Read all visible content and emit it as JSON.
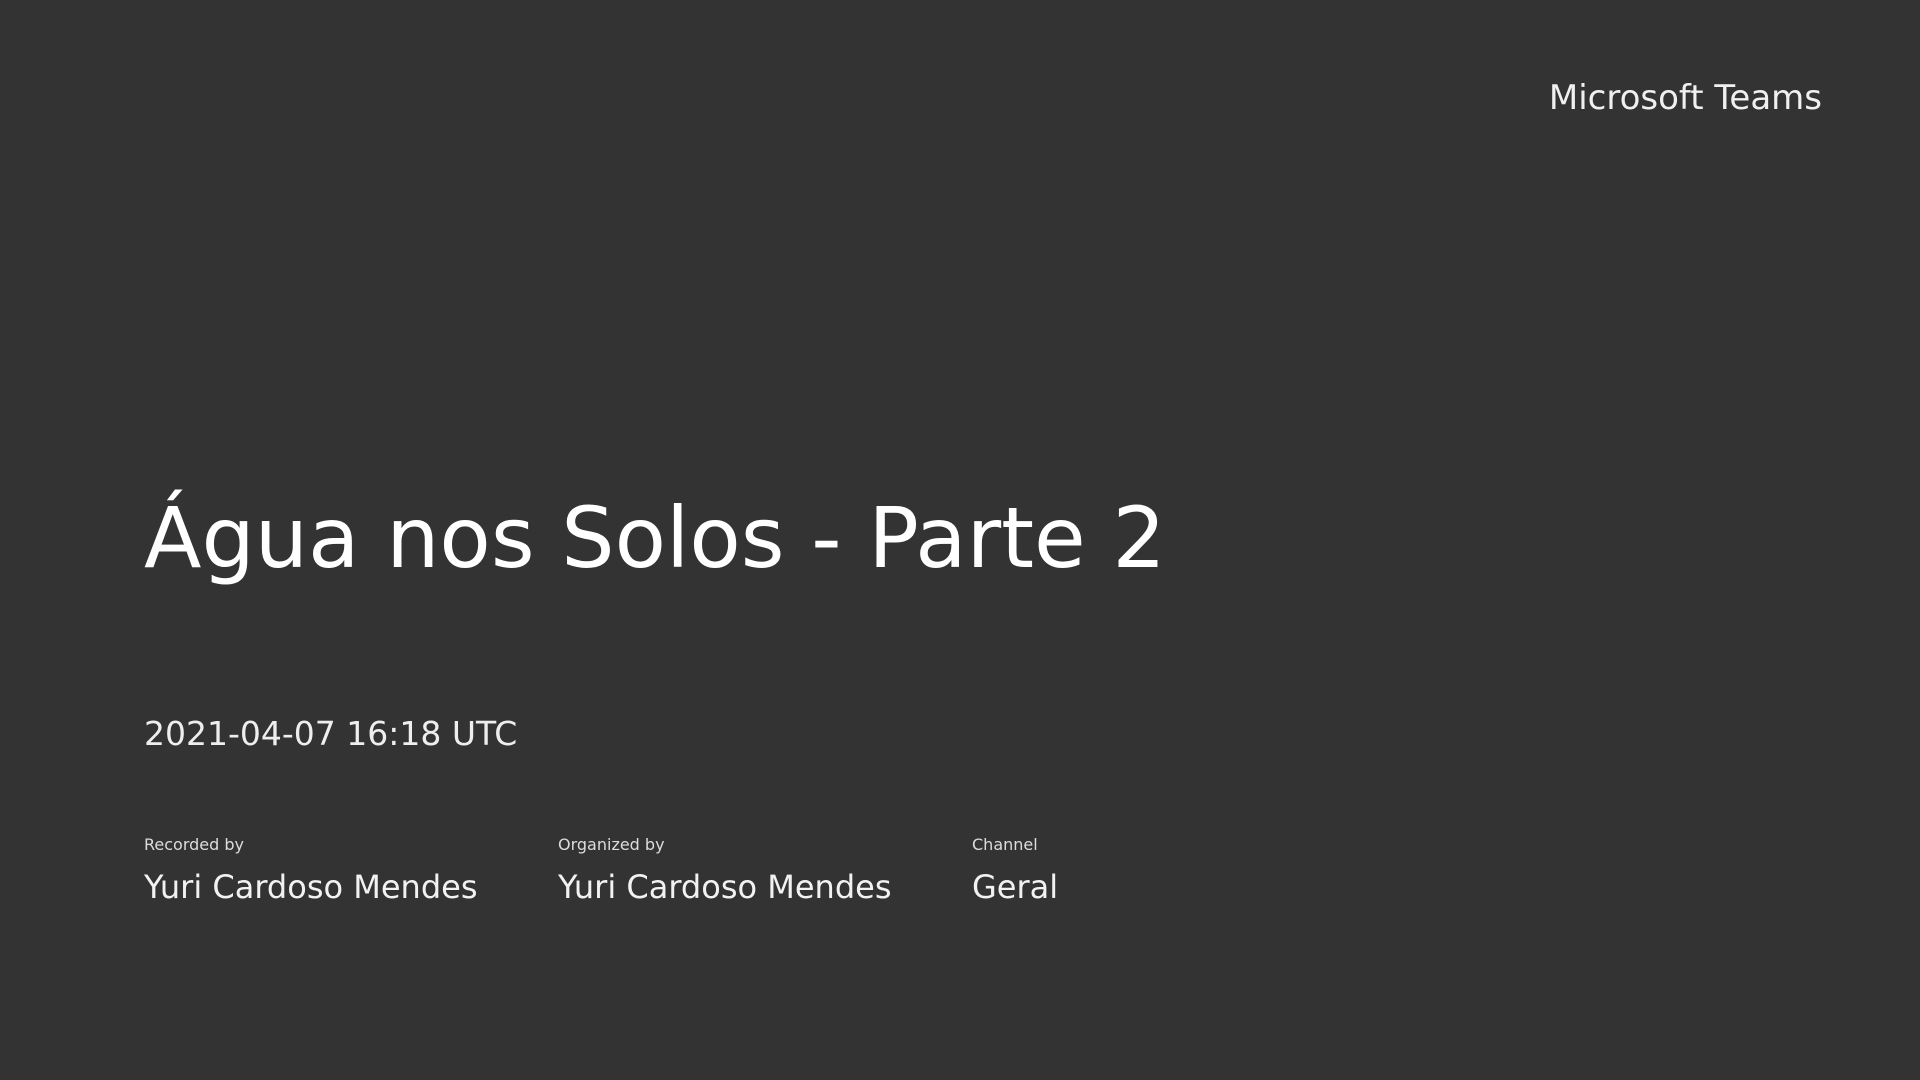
{
  "brand": {
    "name": "Microsoft Teams"
  },
  "recording": {
    "title": "Água nos Solos - Parte 2",
    "datetime": "2021-04-07 16:18 UTC"
  },
  "meta": {
    "recorded_by": {
      "label": "Recorded by",
      "value": "Yuri Cardoso Mendes"
    },
    "organized_by": {
      "label": "Organized by",
      "value": "Yuri Cardoso Mendes"
    },
    "channel": {
      "label": "Channel",
      "value": "Geral"
    }
  },
  "colors": {
    "background": "#333333",
    "text": "#f2f2f2"
  }
}
